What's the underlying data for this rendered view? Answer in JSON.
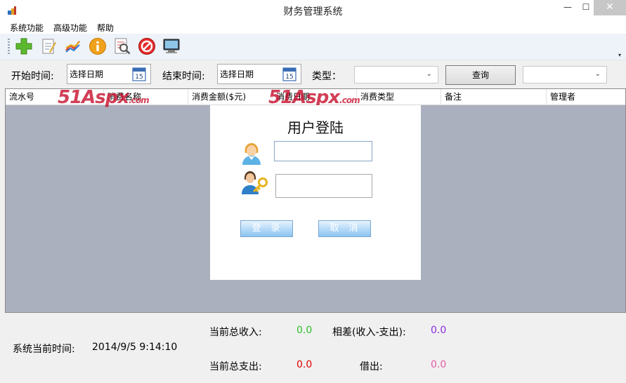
{
  "window": {
    "title": "财务管理系统",
    "min_glyph": "—",
    "max_glyph": "☐",
    "close_glyph": "✕"
  },
  "menu": [
    "系统功能",
    "高级功能",
    "帮助"
  ],
  "toolbar": {
    "buttons": [
      "add-icon",
      "edit-note-icon",
      "chart-icon",
      "info-icon",
      "search-document-icon",
      "stop-icon",
      "monitor-icon"
    ],
    "overflow_glyph": "▾"
  },
  "search": {
    "start_label": "开始时间:",
    "start_placeholder": "选择日期",
    "end_label": "结束时间:",
    "end_placeholder": "选择日期",
    "type_label": "类型：",
    "type_value": "",
    "query_button": "查询",
    "extra_value": "",
    "dropdown_glyph": "⌄",
    "calendar_number": "15"
  },
  "grid": {
    "columns": [
      "流水号",
      "消费名称",
      "消费金额($元)",
      "消费日期",
      "消费类型",
      "备注",
      "管理者"
    ],
    "rows": []
  },
  "watermarks": [
    {
      "brand": "51Aspx",
      "domain": ".com"
    },
    {
      "brand": "51Aspx",
      "domain": ".com"
    }
  ],
  "login": {
    "title": "用户登陆",
    "username_value": "",
    "password_value": "",
    "login_button": "登录",
    "cancel_button": "取消"
  },
  "status": {
    "time_label": "系统当前时间:",
    "time_value": "2014/9/5 9:14:10",
    "income_label": "当前总收入:",
    "income_value": "0.0",
    "expense_label": "当前总支出:",
    "expense_value": "0.0",
    "diff_label": "相差(收入-支出):",
    "diff_value": "0.0",
    "borrow_label": "借出:",
    "borrow_value": "0.0",
    "colors": {
      "income": "#2ec02e",
      "expense": "#e00000",
      "diff": "#8a2be2",
      "borrow": "#e75aa5"
    }
  }
}
